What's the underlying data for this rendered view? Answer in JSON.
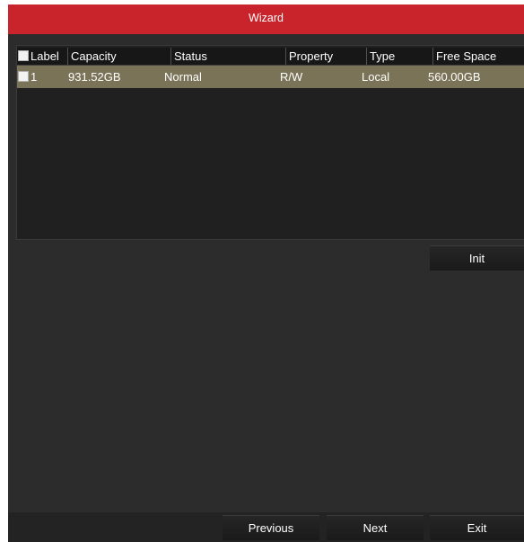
{
  "window": {
    "title": "Wizard",
    "accent_color": "#c9232b"
  },
  "hdd_table": {
    "columns": [
      "Label",
      "Capacity",
      "Status",
      "Property",
      "Type",
      "Free Space"
    ],
    "rows": [
      {
        "label": "1",
        "capacity": "931.52GB",
        "status": "Normal",
        "property": "R/W",
        "type": "Local",
        "free_space": "560.00GB",
        "selected": true
      }
    ],
    "selected_row_color": "#7a7358"
  },
  "actions": {
    "init_label": "Init"
  },
  "footer": {
    "previous_label": "Previous",
    "next_label": "Next",
    "exit_label": "Exit"
  }
}
